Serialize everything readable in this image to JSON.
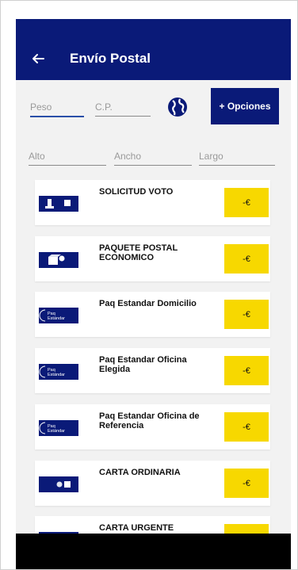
{
  "header": {
    "title": "Envío Postal"
  },
  "form": {
    "peso_placeholder": "Peso",
    "cp_placeholder": "C.P.",
    "alto_placeholder": "Alto",
    "ancho_placeholder": "Ancho",
    "largo_placeholder": "Largo",
    "options_label": "+ Opciones"
  },
  "colors": {
    "brand": "#0a1a78",
    "price": "#f7d800"
  },
  "products": [
    {
      "name": "SOLICITUD VOTO",
      "price": "-€",
      "icon": "vote-ballot-icon"
    },
    {
      "name": "PAQUETE POSTAL ECONOMICO",
      "price": "-€",
      "icon": "parcel-icon"
    },
    {
      "name": "Paq Estandar Domicilio",
      "price": "-€",
      "icon": "paq-estandar-icon",
      "icon_text": "Paq Estándar"
    },
    {
      "name": "Paq Estandar Oficina Elegida",
      "price": "-€",
      "icon": "paq-estandar-icon",
      "icon_text": "Paq Estándar"
    },
    {
      "name": "Paq Estandar Oficina de Referencia",
      "price": "-€",
      "icon": "paq-estandar-icon",
      "icon_text": "Paq Estándar"
    },
    {
      "name": "CARTA ORDINARIA",
      "price": "-€",
      "icon": "letter-icon"
    },
    {
      "name": "CARTA URGENTE",
      "price": "-€",
      "icon": "letter-urgent-icon"
    }
  ]
}
